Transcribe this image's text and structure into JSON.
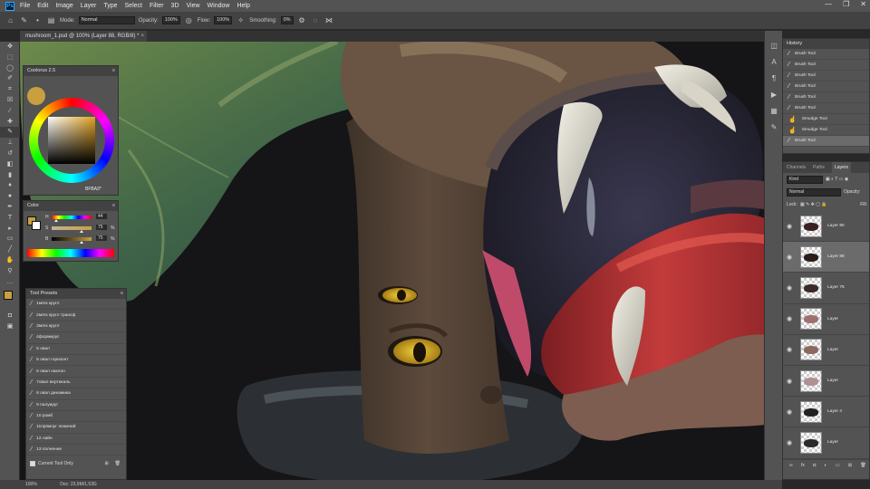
{
  "menubar": {
    "app_icon": "Ps",
    "items": [
      "File",
      "Edit",
      "Image",
      "Layer",
      "Type",
      "Select",
      "Filter",
      "3D",
      "View",
      "Window",
      "Help"
    ],
    "window_controls": [
      "—",
      "❐",
      "✕"
    ]
  },
  "options": {
    "mode_label": "Mode:",
    "mode_value": "Normal",
    "opacity_label": "Opacity:",
    "opacity_value": "100%",
    "flow_label": "Flow:",
    "flow_value": "100%",
    "smoothing_label": "Smoothing:",
    "smoothing_value": "0%"
  },
  "document": {
    "tab_title": "mushroom_1.psd @ 100% (Layer 88, RGB/8) *",
    "close": "×"
  },
  "status": {
    "zoom": "100%",
    "doc_size": "Doc: 23,9M/1,53G"
  },
  "coolorus": {
    "title": "Coolorus 2.5",
    "hex": "BFBA3*"
  },
  "color_panel": {
    "title": "Color",
    "channels": [
      {
        "label": "H",
        "value": "44",
        "fill": 0.12
      },
      {
        "label": "S",
        "value": "75",
        "fill": 0.75
      },
      {
        "label": "B",
        "value": "75",
        "fill": 0.75
      }
    ],
    "units": [
      "",
      "%",
      "%"
    ]
  },
  "tool_presets": {
    "title": "Tool Presets",
    "items": [
      "1мягк кругл",
      "2мягк кругл трансф",
      "3мягк кругл",
      "4формирус",
      "5 овал",
      "6 овал горизонт",
      "6 овал наклон",
      "7овал вертикаль",
      "8 овал динамика",
      "9 палуируг",
      "10 ромб",
      "11прямоуг лежачий",
      "12 лайн",
      "13 полнениe"
    ],
    "current_tool_only": "Current Tool Only"
  },
  "history": {
    "title": "History",
    "items": [
      {
        "label": "Brush Tool",
        "icon": "brush-icon"
      },
      {
        "label": "Brush Tool",
        "icon": "brush-icon"
      },
      {
        "label": "Brush Tool",
        "icon": "brush-icon"
      },
      {
        "label": "Brush Tool",
        "icon": "brush-icon"
      },
      {
        "label": "Brush Tool",
        "icon": "brush-icon"
      },
      {
        "label": "Brush Tool",
        "icon": "brush-icon"
      },
      {
        "label": "Smudge Tool",
        "icon": "smudge-icon"
      },
      {
        "label": "Smudge Tool",
        "icon": "smudge-icon"
      },
      {
        "label": "Brush Tool",
        "icon": "brush-icon"
      }
    ]
  },
  "layers": {
    "tabs": [
      "Channels",
      "Paths",
      "Layers"
    ],
    "kind": "Kind",
    "blend": "Normal",
    "opacity_label": "Opacity:",
    "lock_label": "Lock:",
    "fill_label": "Fill:",
    "items": [
      {
        "name": "Layer 80"
      },
      {
        "name": "Layer 88"
      },
      {
        "name": "Layer 76"
      },
      {
        "name": "Layer"
      },
      {
        "name": "Layer"
      },
      {
        "name": "Layer"
      },
      {
        "name": "Layer 4"
      },
      {
        "name": "Layer"
      }
    ]
  },
  "colors": {
    "foreground": "#c8a040",
    "background": "#ffffff",
    "accent": "#31a8ff"
  }
}
